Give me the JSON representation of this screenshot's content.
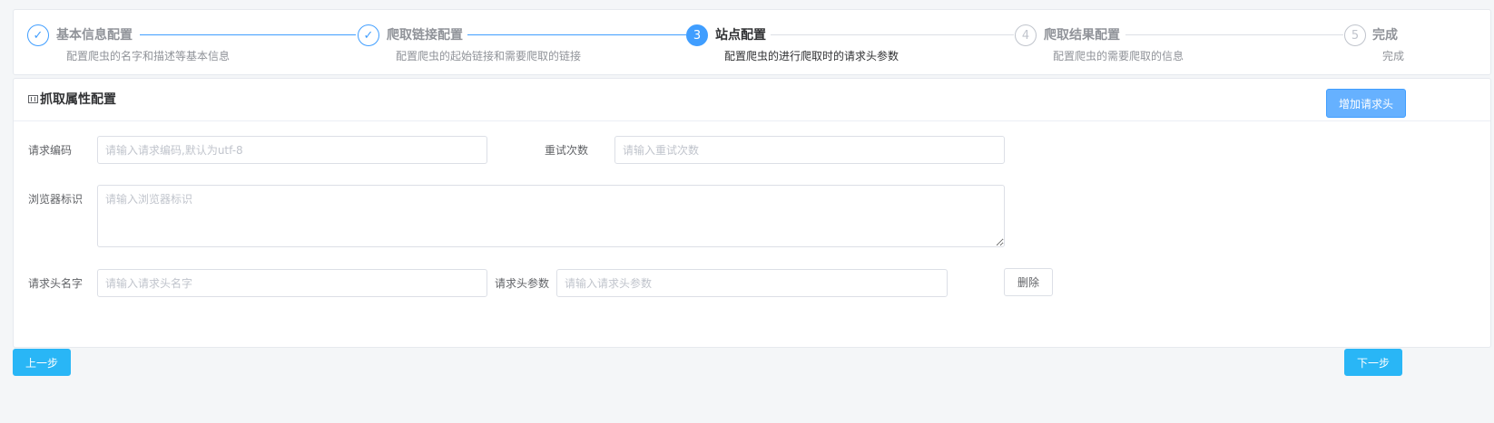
{
  "steps": [
    {
      "index": "1",
      "title": "基本信息配置",
      "desc": "配置爬虫的名字和描述等基本信息",
      "status": "done"
    },
    {
      "index": "2",
      "title": "爬取链接配置",
      "desc": "配置爬虫的起始链接和需要爬取的链接",
      "status": "done"
    },
    {
      "index": "3",
      "title": "站点配置",
      "desc": "配置爬虫的进行爬取时的请求头参数",
      "status": "active"
    },
    {
      "index": "4",
      "title": "爬取结果配置",
      "desc": "配置爬虫的需要爬取的信息",
      "status": "wait"
    },
    {
      "index": "5",
      "title": "完成",
      "desc": "完成",
      "status": "wait"
    }
  ],
  "step_check_glyph": "✓",
  "form": {
    "title": "抓取属性配置",
    "title_icon": "film-icon",
    "add_header_label": "增加请求头",
    "encoding": {
      "label": "请求编码",
      "value": "",
      "placeholder": "请输入请求编码,默认为utf-8"
    },
    "retry": {
      "label": "重试次数",
      "value": "",
      "placeholder": "请输入重试次数"
    },
    "user_agent": {
      "label": "浏览器标识",
      "value": "",
      "placeholder": "请输入浏览器标识"
    },
    "header_name": {
      "label": "请求头名字",
      "value": "",
      "placeholder": "请输入请求头名字"
    },
    "header_value": {
      "label": "请求头参数",
      "value": "",
      "placeholder": "请输入请求头参数"
    },
    "delete_label": "删除"
  },
  "nav": {
    "prev_label": "上一步",
    "next_label": "下一步"
  },
  "colors": {
    "primary": "#409eff",
    "button_cyan": "#29b6f6",
    "page_bg": "#f4f6f8"
  }
}
